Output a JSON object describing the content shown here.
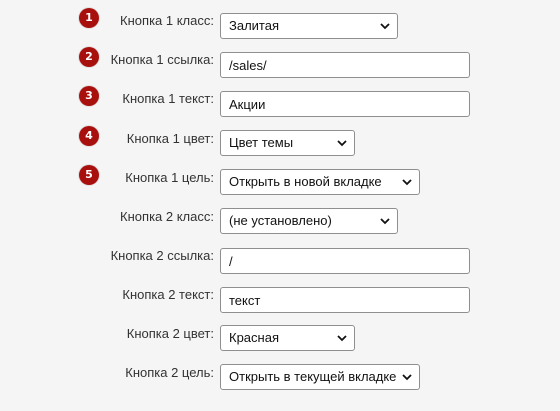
{
  "fields": [
    {
      "label": "Кнопка 1 класс:",
      "type": "select",
      "value": "Залитая",
      "marker": "1"
    },
    {
      "label": "Кнопка 1 ссылка:",
      "type": "text",
      "value": "/sales/",
      "marker": "2"
    },
    {
      "label": "Кнопка 1 текст:",
      "type": "text",
      "value": "Акции",
      "marker": "3"
    },
    {
      "label": "Кнопка 1 цвет:",
      "type": "select",
      "value": "Цвет темы",
      "marker": "4"
    },
    {
      "label": "Кнопка 1 цель:",
      "type": "select",
      "value": "Открыть в новой вкладке",
      "marker": "5"
    },
    {
      "label": "Кнопка 2 класс:",
      "type": "select",
      "value": "(не установлено)",
      "marker": ""
    },
    {
      "label": "Кнопка 2 ссылка:",
      "type": "text",
      "value": "/",
      "marker": ""
    },
    {
      "label": "Кнопка 2 текст:",
      "type": "text",
      "value": "текст",
      "marker": ""
    },
    {
      "label": "Кнопка 2 цвет:",
      "type": "select",
      "value": "Красная",
      "marker": ""
    },
    {
      "label": "Кнопка 2 цель:",
      "type": "select",
      "value": "Открыть в текущей вкладке",
      "marker": ""
    }
  ],
  "icons": {
    "dropdown": "chevron-down-icon",
    "marker": "numbered-step-marker"
  },
  "colors": {
    "marker_bg": "#a8100e",
    "page_bg": "#f5f5f5"
  }
}
